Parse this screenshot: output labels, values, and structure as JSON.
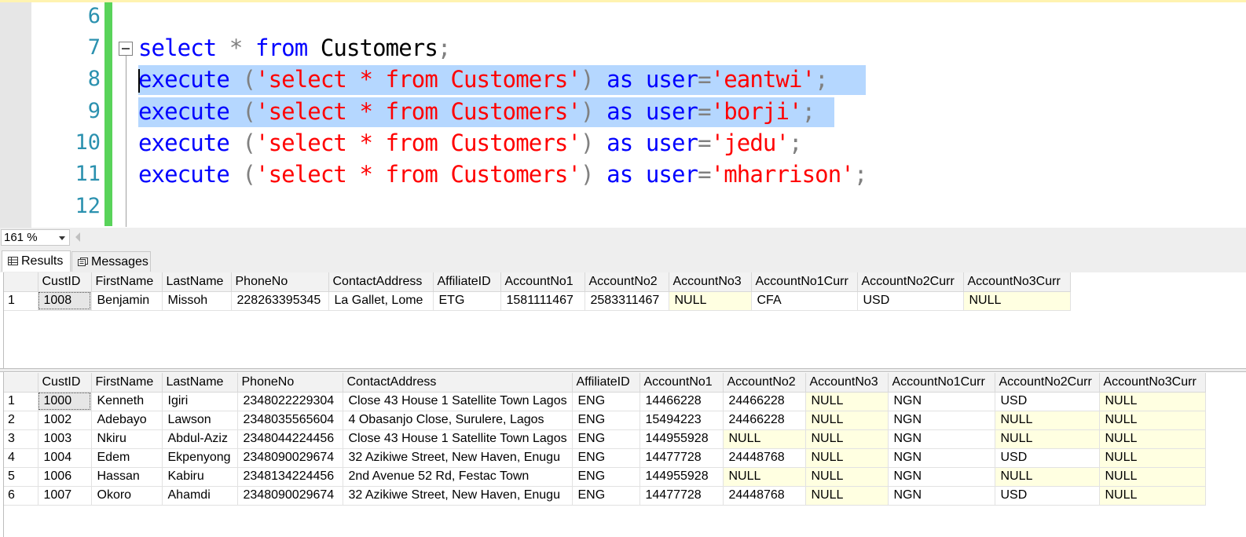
{
  "editor": {
    "lines": [
      {
        "num": "6"
      },
      {
        "num": "7"
      },
      {
        "num": "8"
      },
      {
        "num": "9"
      },
      {
        "num": "10"
      },
      {
        "num": "11"
      },
      {
        "num": "12"
      }
    ],
    "tokens": {
      "select": "select",
      "star": "*",
      "from": "from",
      "customers": "Customers",
      "semi": ";",
      "execute": "execute",
      "lparen": "(",
      "query": "'select * from Customers'",
      "rparen": ")",
      "as": "as",
      "user": "user",
      "eq": "=",
      "u1": "'eantwi'",
      "u2": "'borji'",
      "u3": "'jedu'",
      "u4": "'mharrison'"
    }
  },
  "zoom": {
    "value": "161 %"
  },
  "tabs": {
    "results": "Results",
    "messages": "Messages"
  },
  "grid1": {
    "columns": [
      "CustID",
      "FirstName",
      "LastName",
      "PhoneNo",
      "ContactAddress",
      "AffiliateID",
      "AccountNo1",
      "AccountNo2",
      "AccountNo3",
      "AccountNo1Curr",
      "AccountNo2Curr",
      "AccountNo3Curr"
    ],
    "rows": [
      [
        "1",
        "1008",
        "Benjamin",
        "Missoh",
        "228263395345",
        "La Gallet, Lome",
        "ETG",
        "1581111467",
        "2583311467",
        "NULL",
        "CFA",
        "USD",
        "NULL"
      ]
    ]
  },
  "grid2": {
    "columns": [
      "CustID",
      "FirstName",
      "LastName",
      "PhoneNo",
      "ContactAddress",
      "AffiliateID",
      "AccountNo1",
      "AccountNo2",
      "AccountNo3",
      "AccountNo1Curr",
      "AccountNo2Curr",
      "AccountNo3Curr"
    ],
    "rows": [
      [
        "1",
        "1000",
        "Kenneth",
        "Igiri",
        "2348022229304",
        "Close 43 House 1 Satellite Town Lagos",
        "ENG",
        "14466228",
        "24466228",
        "NULL",
        "NGN",
        "USD",
        "NULL"
      ],
      [
        "2",
        "1002",
        "Adebayo",
        "Lawson",
        "2348035565604",
        "4 Obasanjo Close, Surulere, Lagos",
        "ENG",
        "15494223",
        "24466228",
        "NULL",
        "NGN",
        "NULL",
        "NULL"
      ],
      [
        "3",
        "1003",
        "Nkiru",
        "Abdul-Aziz",
        "2348044224456",
        "Close 43 House 1 Satellite Town Lagos",
        "ENG",
        "144955928",
        "NULL",
        "NULL",
        "NGN",
        "NULL",
        "NULL"
      ],
      [
        "4",
        "1004",
        "Edem",
        "Ekpenyong",
        "2348090029674",
        "32 Azikiwe Street, New Haven, Enugu",
        "ENG",
        "14477728",
        "24448768",
        "NULL",
        "NGN",
        "USD",
        "NULL"
      ],
      [
        "5",
        "1006",
        "Hassan",
        "Kabiru",
        "2348134224456",
        "2nd Avenue 52 Rd, Festac Town",
        "ENG",
        "144955928",
        "NULL",
        "NULL",
        "NGN",
        "NULL",
        "NULL"
      ],
      [
        "6",
        "1007",
        "Okoro",
        "Ahamdi",
        "2348090029674",
        "32 Azikiwe Street, New Haven, Enugu",
        "ENG",
        "14477728",
        "24448768",
        "NULL",
        "NGN",
        "USD",
        "NULL"
      ]
    ]
  }
}
